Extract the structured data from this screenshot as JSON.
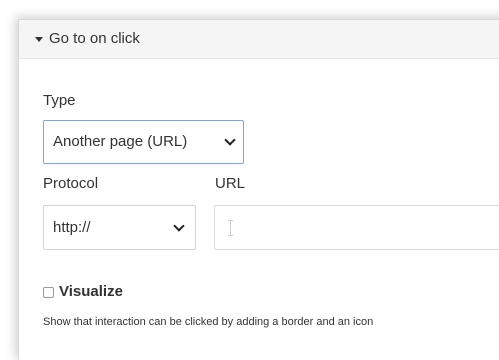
{
  "section": {
    "title": "Go to on click",
    "expanded": true
  },
  "type_field": {
    "label": "Type",
    "selected": "Another page (URL)"
  },
  "protocol_field": {
    "label": "Protocol",
    "selected": "http://"
  },
  "url_field": {
    "label": "URL",
    "value": ""
  },
  "visualize": {
    "label": "Visualize",
    "checked": false,
    "hint": "Show that interaction can be clicked by adding a border and an icon"
  },
  "icons": {
    "section_toggle": "caret-down-icon",
    "select_arrow": "chevron-down-icon",
    "text_cursor": "text-cursor-icon"
  },
  "colors": {
    "header_bg": "#f5f5f5",
    "focus_border": "#7ea6d8",
    "text": "#333333"
  }
}
